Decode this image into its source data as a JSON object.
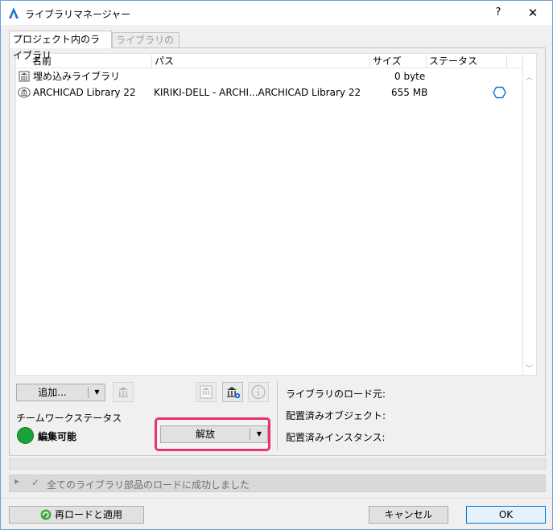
{
  "window": {
    "title": "ライブラリマネージャー",
    "help_label": "?",
    "close_label": "✕"
  },
  "tabs": [
    {
      "label": "プロジェクト内のライブラリ",
      "active": true
    },
    {
      "label": "ライブラリの内容",
      "active": false
    }
  ],
  "library_list": {
    "columns": [
      "名前",
      "パス",
      "サイズ",
      "ステータス"
    ],
    "rows": [
      {
        "name": "埋め込みライブラリ",
        "path": "",
        "size": "0 byte",
        "icon": "embedded-library-icon",
        "status_icon": ""
      },
      {
        "name": "ARCHICAD Library 22",
        "path": "KIRIKI-DELL - ARCHI...ARCHICAD Library 22",
        "size": "655 MB",
        "icon": "library-icon",
        "status_icon": "hexagon-status-icon"
      }
    ]
  },
  "left_controls": {
    "add_label": "追加...",
    "dropdown_arrow": "▼",
    "teamwork_status_label": "チームワークステータス",
    "status_text": "編集可能",
    "status_color": "#1aa33a",
    "release_label": "解放"
  },
  "info_labels": {
    "load_source": "ライブラリのロード元:",
    "placed_objects": "配置済みオブジェクト:",
    "placed_instances": "配置済みインスタンス:"
  },
  "message": {
    "text": "全てのライブラリ部品のロードに成功しました",
    "expand_arrow": "▶",
    "check": "✓"
  },
  "footer": {
    "reload_label": "再ロードと適用",
    "cancel_label": "キャンセル",
    "ok_label": "OK"
  },
  "colors": {
    "accent_border": "#0078d7",
    "highlight": "#e8336d",
    "status_icon": "#1d6fd6"
  }
}
